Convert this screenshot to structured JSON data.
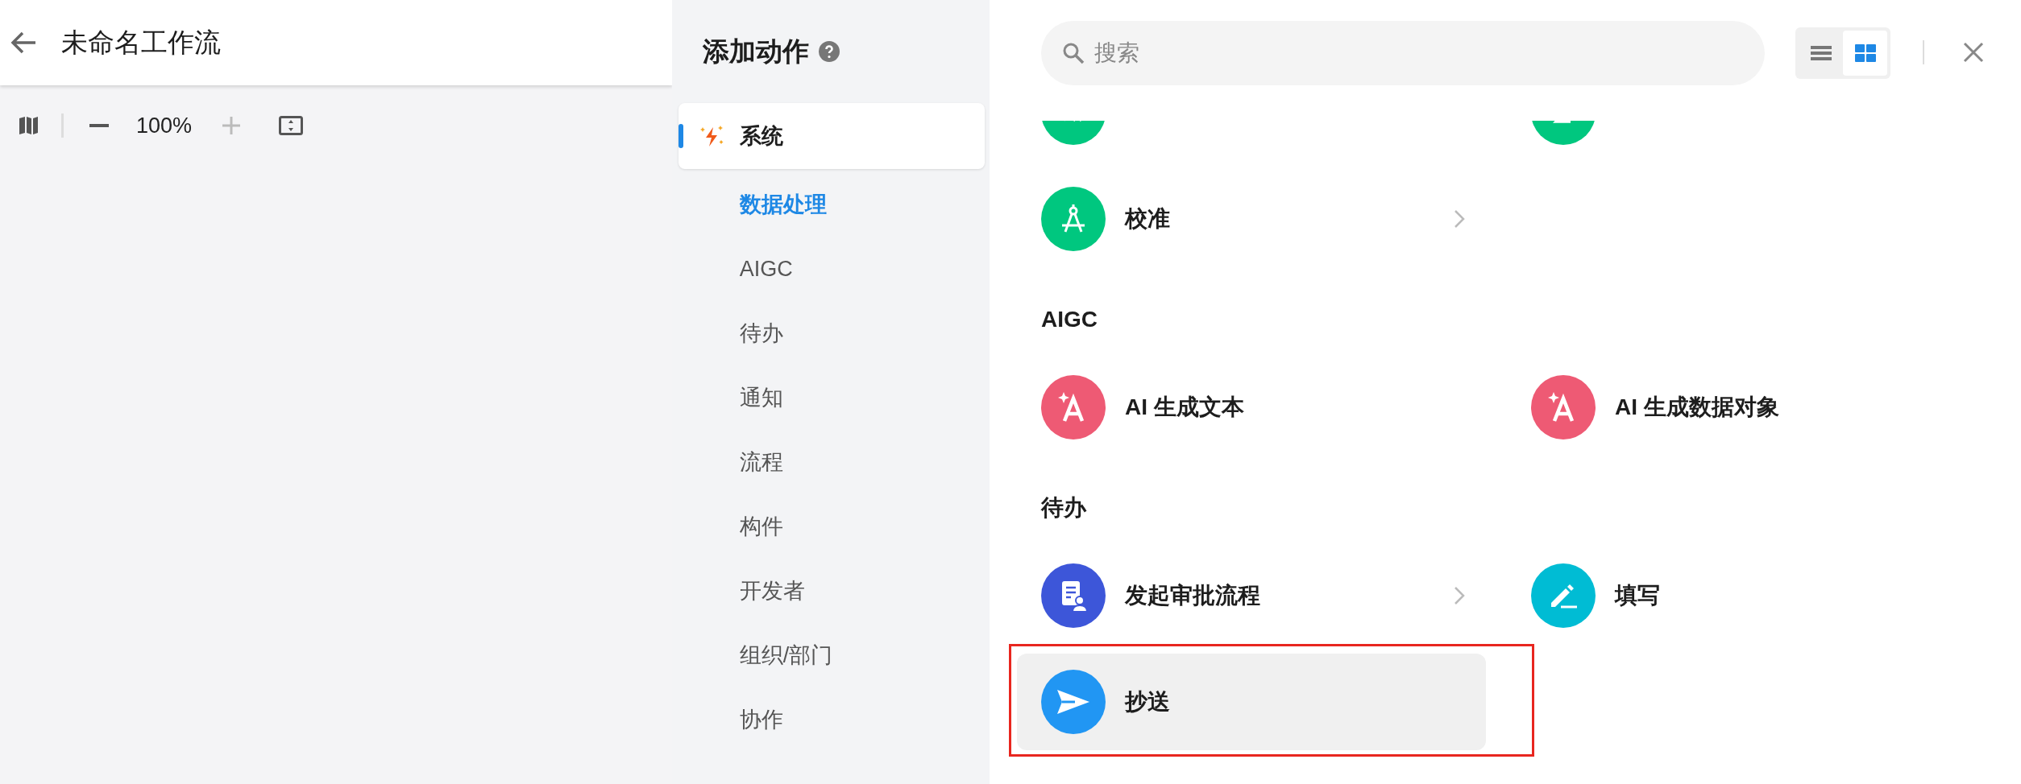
{
  "editor": {
    "title": "未命名工作流",
    "zoom": "100%"
  },
  "sidebar": {
    "title": "添加动作",
    "items": [
      {
        "label": "系统",
        "kind": "group",
        "selected": true
      },
      {
        "label": "数据处理",
        "kind": "sub",
        "selected": true
      },
      {
        "label": "AIGC",
        "kind": "sub",
        "selected": false
      },
      {
        "label": "待办",
        "kind": "sub",
        "selected": false
      },
      {
        "label": "通知",
        "kind": "sub",
        "selected": false
      },
      {
        "label": "流程",
        "kind": "sub",
        "selected": false
      },
      {
        "label": "构件",
        "kind": "sub",
        "selected": false
      },
      {
        "label": "开发者",
        "kind": "sub",
        "selected": false
      },
      {
        "label": "组织/部门",
        "kind": "sub",
        "selected": false
      },
      {
        "label": "协作",
        "kind": "sub",
        "selected": false
      }
    ]
  },
  "search": {
    "placeholder": "搜索"
  },
  "view_toggle": [
    {
      "kind": "list",
      "selected": false
    },
    {
      "kind": "grid",
      "selected": true
    }
  ],
  "sections": [
    {
      "rows": [
        [
          {
            "kind": "formula",
            "color": "#00c77f"
          },
          {
            "kind": "sum",
            "color": "#00c77f"
          }
        ],
        [
          {
            "label": "校准",
            "kind": "calibrate",
            "color": "#00c77f",
            "has_children": true
          }
        ]
      ]
    },
    {
      "title": "AIGC",
      "rows": [
        [
          {
            "label": "AI 生成文本",
            "kind": "ai",
            "color": "#ee5a74",
            "has_children": false
          },
          {
            "label": "AI 生成数据对象",
            "kind": "ai",
            "color": "#ee5a74",
            "has_children": false
          }
        ]
      ]
    },
    {
      "title": "待办",
      "rows": [
        [
          {
            "label": "发起审批流程",
            "kind": "approval",
            "color": "#3d56d9",
            "has_children": true
          },
          {
            "label": "填写",
            "kind": "fill",
            "color": "#00bcd4",
            "has_children": false
          }
        ],
        [
          {
            "label": "抄送",
            "kind": "send",
            "color": "#2196f3",
            "has_children": false,
            "hovered": true,
            "outlined": true
          }
        ]
      ]
    }
  ]
}
